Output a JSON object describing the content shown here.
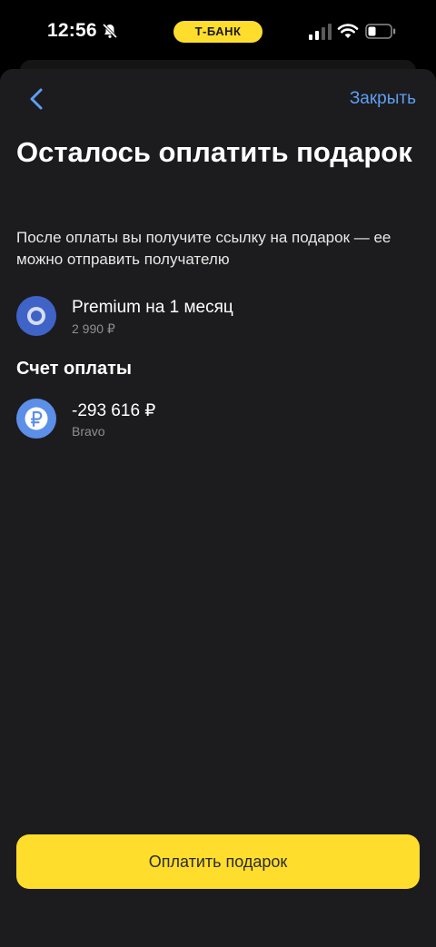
{
  "status_bar": {
    "time": "12:56",
    "carrier_pill": "Т-БАНК",
    "icons": [
      "bell-slash-icon",
      "signal-icon",
      "wifi-icon",
      "battery-icon"
    ]
  },
  "header": {
    "back_icon": "chevron-left-icon",
    "close_label": "Закрыть"
  },
  "main": {
    "title": "Осталось оплатить подарок",
    "subtitle": "После оплаты вы получите ссылку на подарок — ее можно отправить получателю",
    "product": {
      "name": "Premium на 1 месяц",
      "price": "2 990 ₽",
      "icon": "premium-ring-icon"
    },
    "account_section_title": "Счет оплаты",
    "account": {
      "balance": "-293 616 ₽",
      "name": "Bravo",
      "icon": "ruble-coin-icon"
    }
  },
  "footer": {
    "pay_button_label": "Оплатить подарок"
  },
  "colors": {
    "accent_yellow": "#FFDD2D",
    "link_blue": "#5E9EF3",
    "sheet_bg": "#1C1C1E",
    "premium_icon": "#3F63C7",
    "account_icon": "#5B8FE8"
  }
}
